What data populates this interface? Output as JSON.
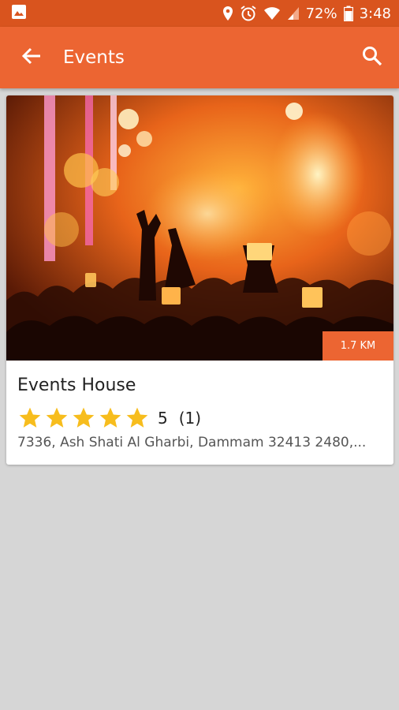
{
  "status_bar": {
    "battery": "72%",
    "time": "3:48",
    "icons": [
      "image-notification-icon",
      "location-icon",
      "alarm-icon",
      "wifi-icon",
      "signal-icon",
      "battery-icon"
    ]
  },
  "app_bar": {
    "title": "Events",
    "icons": [
      "back-arrow-icon",
      "search-icon"
    ],
    "color": "#ec6532"
  },
  "card": {
    "image_description_icon": "concert-crowd-image",
    "distance": "1.7 KM",
    "title": "Events House",
    "rating": "5",
    "rating_fraction": 1.0,
    "review_count": "(1)",
    "address": "7336, Ash Shati Al Gharbi, Dammam 32413 2480,...",
    "star_color": "#f7bd1d"
  }
}
